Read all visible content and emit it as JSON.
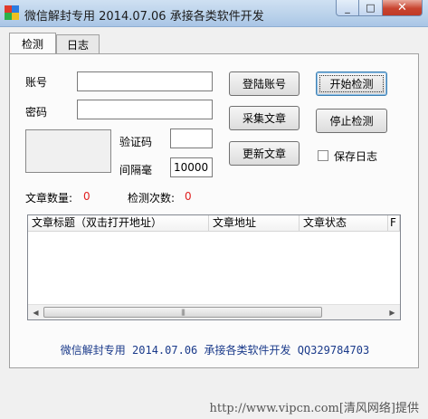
{
  "window": {
    "title": "微信解封专用 2014.07.06 承接各类软件开发",
    "close_glyph": "✕",
    "max_glyph": "□",
    "min_glyph": "_"
  },
  "tabs": [
    {
      "label": "检测",
      "active": true
    },
    {
      "label": "日志",
      "active": false
    }
  ],
  "form": {
    "account_label": "账号",
    "account_value": "",
    "password_label": "密码",
    "password_value": "",
    "captcha_label": "验证码",
    "captcha_value": "",
    "interval_label": "间隔毫",
    "interval_value": "10000"
  },
  "buttons": {
    "login": "登陆账号",
    "collect": "采集文章",
    "update": "更新文章",
    "start": "开始检测",
    "stop": "停止检测"
  },
  "options": {
    "save_log_label": "保存日志",
    "save_log_checked": false
  },
  "stats": {
    "article_count_label": "文章数量:",
    "article_count_value": "0",
    "check_count_label": "检测次数:",
    "check_count_value": "0"
  },
  "table": {
    "columns": [
      "文章标题（双击打开地址）",
      "文章地址",
      "文章状态",
      "F"
    ],
    "rows": []
  },
  "footer": {
    "text": "微信解封专用 2014.07.06 承接各类软件开发 QQ329784703"
  },
  "watermark": "http://www.vipcn.com[清风网络]提供",
  "icons": {
    "app": "app-icon",
    "scroll_left": "◀",
    "scroll_right": "▶",
    "thumb_grip": "|||"
  }
}
